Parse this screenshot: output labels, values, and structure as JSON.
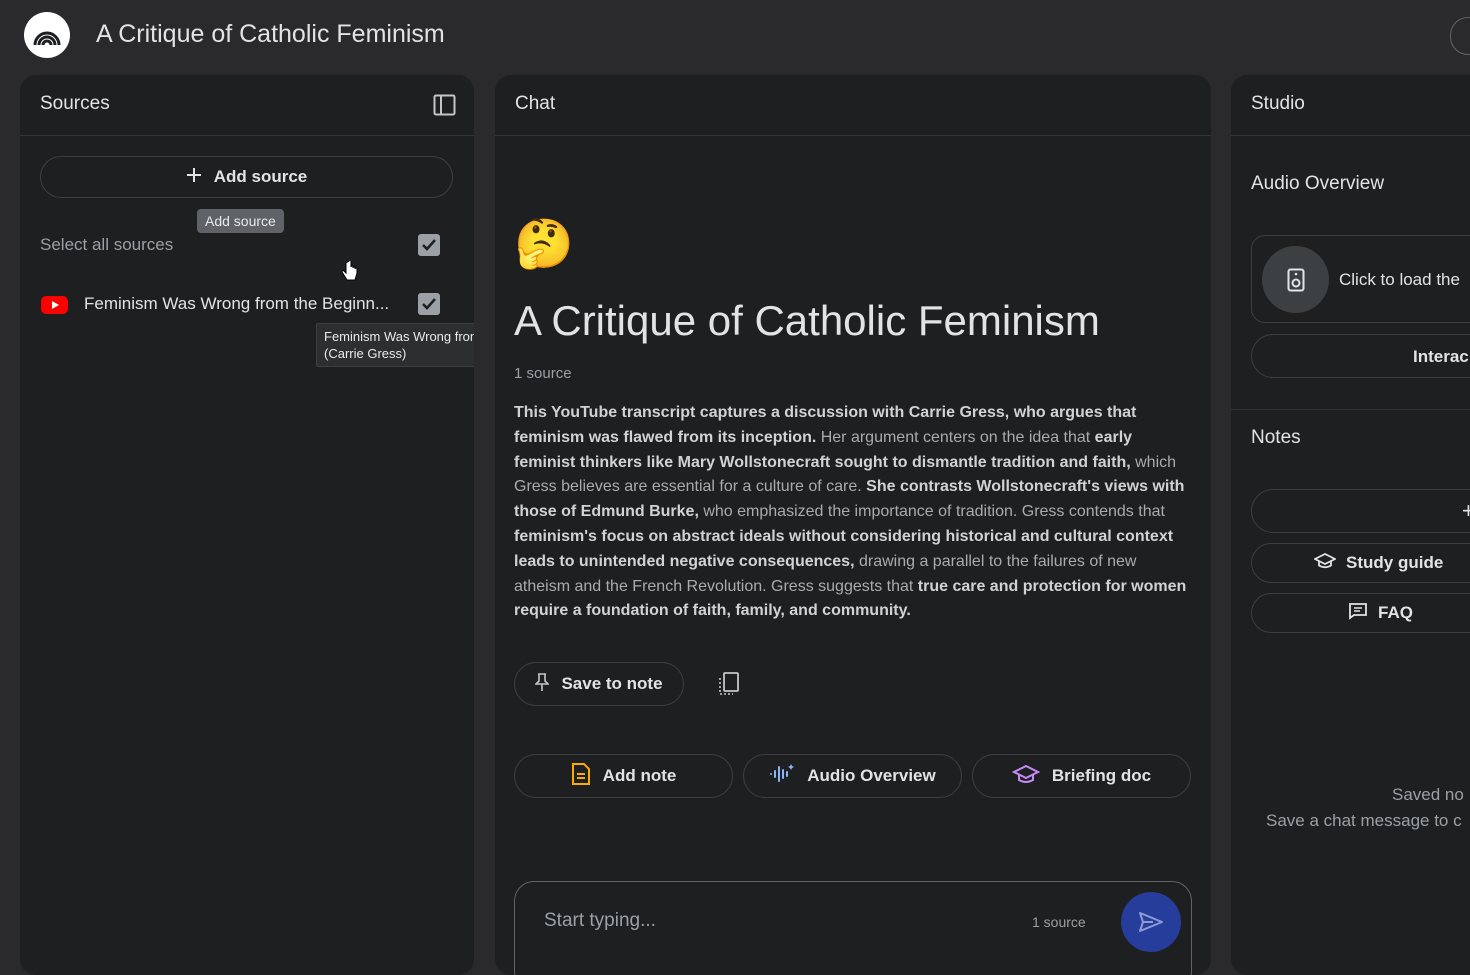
{
  "app": {
    "title": "A Critique of Catholic Feminism"
  },
  "sources": {
    "title": "Sources",
    "add_source_label": "Add source",
    "add_source_tooltip": "Add source",
    "select_all_label": "Select all sources",
    "items": [
      {
        "name": "Feminism Was Wrong from the Beginn...",
        "tooltip_line1": "Feminism Was Wrong from the Beginning",
        "tooltip_line2": "(Carrie Gress)",
        "checked": true,
        "icon": "youtube-icon"
      }
    ]
  },
  "chat": {
    "title": "Chat",
    "emoji": "🤔",
    "heading": "A Critique of Catholic Feminism",
    "source_count": "1 source",
    "summary": {
      "s1": "This YouTube transcript captures a discussion with Carrie Gress, who argues that feminism was flawed from its inception.",
      "s2": " Her argument centers on the idea that ",
      "s3": "early feminist thinkers like Mary Wollstonecraft sought to dismantle tradition and faith,",
      "s4": " which Gress believes are essential for a culture of care. ",
      "s5": "She contrasts Wollstonecraft's views with those of Edmund Burke,",
      "s6": " who emphasized the importance of tradition. Gress contends that ",
      "s7": "feminism's focus on abstract ideals without considering historical and cultural context leads to unintended negative consequences,",
      "s8": " drawing a parallel to the failures of new atheism and the French Revolution. Gress suggests that ",
      "s9": "true care and protection for women require a foundation of faith, family, and community."
    },
    "save_to_note": "Save to note",
    "actions": {
      "add_note": "Add note",
      "audio_overview": "Audio Overview",
      "briefing_doc": "Briefing doc"
    },
    "input": {
      "placeholder": "Start typing...",
      "source_count": "1 source"
    }
  },
  "studio": {
    "title": "Studio",
    "audio_overview_label": "Audio Overview",
    "audio_card_text": "Click to load the",
    "interactive_label": "Interac",
    "notes_label": "Notes",
    "add_note_symbol": "+",
    "study_guide": "Study guide",
    "faq": "FAQ",
    "saved_title": "Saved no",
    "saved_sub": "Save a chat message to c"
  },
  "colors": {
    "background": "#2a2a2c",
    "panel": "#1e1f20",
    "send_button": "#263d9c",
    "youtube_red": "#ff0000",
    "note_icon_orange": "#f9ab00",
    "audio_icon_blue": "#8ab4f8",
    "briefing_icon_purple": "#c58af9"
  }
}
